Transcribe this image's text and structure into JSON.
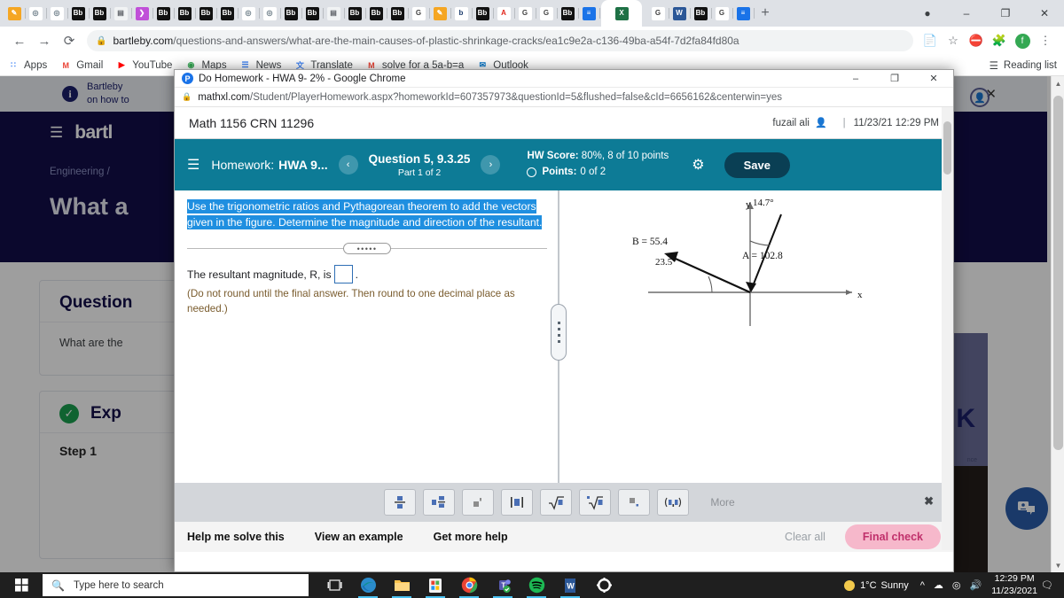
{
  "browser": {
    "tabs": [
      {
        "icon": "pencil-orange-icon",
        "type": "orange"
      },
      {
        "icon": "globe-icon",
        "type": "green"
      },
      {
        "icon": "globe-icon",
        "type": "green"
      },
      {
        "icon": "blackboard-icon",
        "type": "bb"
      },
      {
        "icon": "blackboard-icon",
        "type": "bb"
      },
      {
        "icon": "document-icon",
        "type": "doc"
      },
      {
        "icon": "purple-arrow-icon",
        "type": "purple"
      },
      {
        "icon": "blackboard-icon",
        "type": "bb"
      },
      {
        "icon": "blackboard-icon",
        "type": "bb"
      },
      {
        "icon": "blackboard-icon",
        "type": "bb"
      },
      {
        "icon": "blackboard-icon",
        "type": "bb"
      },
      {
        "icon": "globe-icon",
        "type": "green"
      },
      {
        "icon": "globe-icon",
        "type": "green"
      },
      {
        "icon": "blackboard-icon",
        "type": "bb"
      },
      {
        "icon": "blackboard-icon",
        "type": "bb"
      },
      {
        "icon": "document-icon",
        "type": "doc"
      },
      {
        "icon": "blackboard-icon",
        "type": "bb"
      },
      {
        "icon": "blackboard-icon",
        "type": "bb"
      },
      {
        "icon": "blackboard-icon",
        "type": "bb"
      },
      {
        "icon": "scissors-icon",
        "type": "white"
      },
      {
        "icon": "pencil-orange-icon",
        "type": "orange"
      },
      {
        "icon": "bartleby-b-icon",
        "type": "navy"
      },
      {
        "icon": "blackboard-icon",
        "type": "bb"
      },
      {
        "icon": "adobe-icon",
        "type": "adobe"
      },
      {
        "icon": "google-g-icon",
        "type": "white"
      },
      {
        "icon": "play-circle-icon",
        "type": "white"
      },
      {
        "icon": "blackboard-icon",
        "type": "bb"
      },
      {
        "icon": "blue-doc-icon",
        "type": "blue"
      }
    ],
    "active_tab_icon": "excel-icon",
    "tabs_after": [
      {
        "icon": "google-g-icon",
        "type": "white"
      },
      {
        "icon": "word-icon",
        "type": "word"
      },
      {
        "icon": "blackboard-icon",
        "type": "bb"
      },
      {
        "icon": "google-g-icon",
        "type": "white"
      },
      {
        "icon": "blue-doc-icon",
        "type": "blue"
      }
    ],
    "new_tab_label": "+",
    "window_controls": {
      "minimize": "–",
      "maximize": "❐",
      "close": "✕"
    },
    "nav": {
      "back": "←",
      "forward": "→",
      "reload": "⟳"
    },
    "url_lock": "🔒",
    "url_host": "bartleby.com",
    "url_path": "/questions-and-answers/what-are-the-main-causes-of-plastic-shrinkage-cracks/ea1c9e2a-c136-49ba-a54f-7d2fa84fd80a",
    "toolbar_icons": [
      "bookmark-folder-icon",
      "star-icon",
      "extension-blocked-icon",
      "puzzle-extension-icon",
      "profile-avatar-icon",
      "three-dot-menu-icon"
    ],
    "profile_letter": "f",
    "bookmarks": [
      {
        "label": "Apps",
        "icon": "apps-grid-icon"
      },
      {
        "label": "Gmail",
        "icon": "gmail-icon"
      },
      {
        "label": "YouTube",
        "icon": "youtube-icon"
      },
      {
        "label": "Maps",
        "icon": "maps-icon"
      },
      {
        "label": "News",
        "icon": "news-icon"
      },
      {
        "label": "Translate",
        "icon": "translate-icon"
      },
      {
        "label": "solve for a 5a-b=a",
        "icon": "gmail-icon"
      },
      {
        "label": "Outlook",
        "icon": "outlook-icon"
      }
    ],
    "reading_list": "Reading list"
  },
  "bartleby": {
    "notice": "Bartleby on how to",
    "close_icon": "✕",
    "logo": "bartl",
    "breadcrumb": "Engineering  /",
    "hero_title": "What a",
    "card1_title": "Question",
    "card1_text": "What are the",
    "expert_title": "Exp",
    "step_label": "Step 1",
    "promo_letter": "K",
    "promo_small": "nce"
  },
  "popup": {
    "title": "Do Homework - HWA 9- 2% - Google Chrome",
    "title_icon": "pearson-p-icon",
    "controls": {
      "minimize": "–",
      "maximize": "❐",
      "close": "✕"
    },
    "url_lock": "🔒",
    "url_host": "mathxl.com",
    "url_path": "/Student/PlayerHomework.aspx?homeworkId=607357973&questionId=5&flushed=false&cId=6656162&centerwin=yes"
  },
  "mathxl": {
    "course": "Math 1156 CRN 11296",
    "user": "fuzail ali",
    "user_icon": "user-silhouette-icon",
    "separator": "|",
    "datetime": "11/23/21 12:29 PM",
    "toolbar": {
      "menu_icon": "hamburger-menu-icon",
      "homework_label": "Homework:",
      "homework_name": "HWA 9...",
      "prev_icon": "‹",
      "next_icon": "›",
      "question_title": "Question 5, 9.3.25",
      "question_part": "Part 1 of 2",
      "hw_score_label": "HW Score:",
      "hw_score_value": "80%, 8 of 10 points",
      "points_label": "Points:",
      "points_value": "0 of 2",
      "settings_icon": "gear-icon",
      "save_label": "Save"
    },
    "question": {
      "prompt": "Use the trigonometric ratios and Pythagorean theorem to add the vectors given in the figure. Determine the magnitude and direction of the resultant.",
      "divider_dots": "•••••",
      "answer_prefix": "The resultant magnitude, R, is",
      "answer_suffix": ".",
      "answer_value": "",
      "note": "(Do not round until the final answer. Then round to one decimal place as needed.)"
    },
    "figure": {
      "y_label": "y",
      "x_label": "x",
      "angle_a": "14.7°",
      "angle_b": "23.5°",
      "vector_a": "A = 102.8",
      "vector_b": "B = 55.4"
    },
    "math_toolbar": {
      "buttons": [
        {
          "name": "fraction-button",
          "glyph": "fraction"
        },
        {
          "name": "mixed-number-button",
          "glyph": "mixed"
        },
        {
          "name": "exponent-button",
          "glyph": "exponent"
        },
        {
          "name": "absolute-value-button",
          "glyph": "abs"
        },
        {
          "name": "square-root-button",
          "glyph": "sqrt"
        },
        {
          "name": "nth-root-button",
          "glyph": "nroot"
        },
        {
          "name": "subscript-button",
          "glyph": "subscript"
        },
        {
          "name": "ordered-pair-button",
          "glyph": "pair"
        }
      ],
      "more_label": "More",
      "close_icon": "✖"
    },
    "bottom": {
      "help_me": "Help me solve this",
      "view_example": "View an example",
      "get_help": "Get more help",
      "clear_all": "Clear all",
      "final_check": "Final check"
    }
  },
  "taskbar": {
    "search_placeholder": "Type here to search",
    "search_icon": "magnifier-icon",
    "start_icon": "windows-start-icon",
    "apps": [
      {
        "name": "task-view-icon"
      },
      {
        "name": "edge-icon"
      },
      {
        "name": "file-explorer-icon"
      },
      {
        "name": "microsoft-store-icon"
      },
      {
        "name": "chrome-icon"
      },
      {
        "name": "teams-icon"
      },
      {
        "name": "spotify-icon"
      },
      {
        "name": "word-icon"
      },
      {
        "name": "settings-gear-icon"
      }
    ],
    "weather_temp": "1°C",
    "weather_desc": "Sunny",
    "tray_icons": [
      "chevron-up-icon",
      "onedrive-icon",
      "wifi-icon",
      "volume-icon"
    ],
    "time": "12:29 PM",
    "date": "11/23/2021",
    "notification_icon": "notification-icon"
  },
  "colors": {
    "mathxl_teal": "#0d7b96",
    "save_dark": "#0a3f54",
    "selection_blue": "#1f8fe0",
    "bartleby_navy": "#120e4a",
    "final_check_pink": "#f6b8cb",
    "taskbar_dark": "#1f1f1f"
  }
}
